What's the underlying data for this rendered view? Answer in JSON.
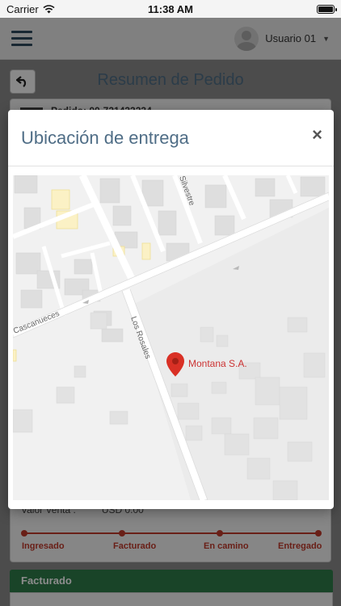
{
  "status_bar": {
    "carrier": "Carrier",
    "time": "11:38 AM"
  },
  "header": {
    "user_name": "Usuario 01"
  },
  "page": {
    "title": "Resumen de Pedido",
    "order_number": "Pedido: 00-721433234",
    "sale_value_label": "Valor Venta :",
    "sale_value": "USD 0.00"
  },
  "timeline": {
    "steps": [
      "Ingresado",
      "Facturado",
      "En camino",
      "Entregado"
    ]
  },
  "section": {
    "billed_title": "Facturado"
  },
  "modal": {
    "title": "Ubicación de entrega",
    "close_label": "×"
  },
  "map": {
    "streets": [
      "Cascanueces",
      "Los Rosales",
      "Silvestre"
    ],
    "marker_label": "Montana S.A."
  },
  "colors": {
    "accent_title": "#4f6d86",
    "timeline_red": "#c0392b",
    "billed_green": "#2e7d4a",
    "marker_red": "#d93025"
  },
  "icons": [
    "hamburger-menu-icon",
    "user-avatar-icon",
    "chevron-down-icon",
    "back-arrow-icon",
    "close-icon",
    "map-pin-icon",
    "wifi-icon",
    "battery-icon"
  ]
}
